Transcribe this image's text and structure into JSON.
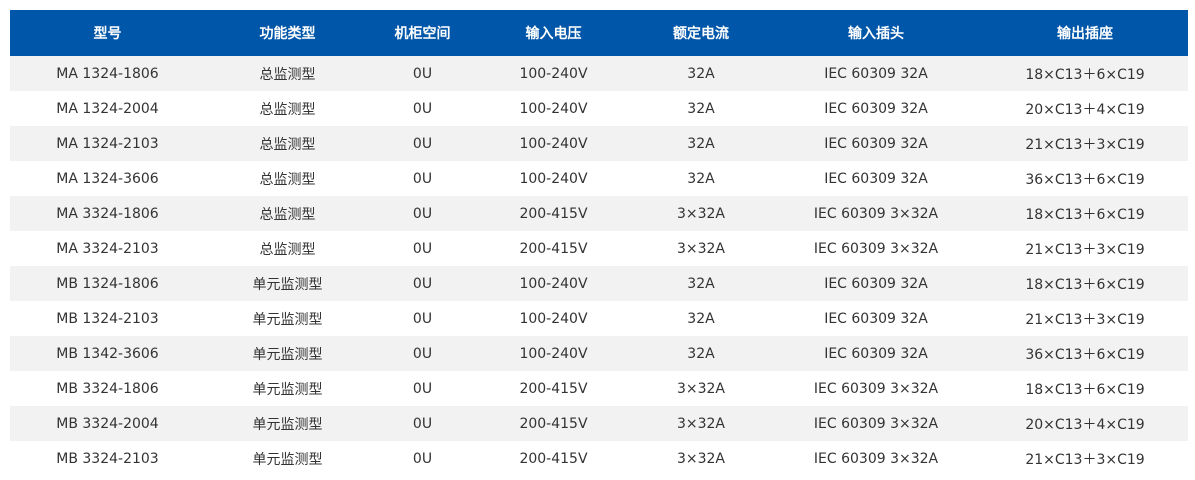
{
  "colors": {
    "header_bg": "#0056a8",
    "header_text": "#ffffff",
    "row_alt": "#f2f2f2",
    "text": "#333333"
  },
  "table": {
    "headers": [
      "型号",
      "功能类型",
      "机柜空间",
      "输入电压",
      "额定电流",
      "输入插头",
      "输出插座"
    ],
    "rows": [
      [
        "MA 1324-1806",
        "总监测型",
        "0U",
        "100-240V",
        "32A",
        "IEC 60309 32A",
        "18×C13＋6×C19"
      ],
      [
        "MA 1324-2004",
        "总监测型",
        "0U",
        "100-240V",
        "32A",
        "IEC 60309 32A",
        "20×C13＋4×C19"
      ],
      [
        "MA 1324-2103",
        "总监测型",
        "0U",
        "100-240V",
        "32A",
        "IEC 60309 32A",
        "21×C13＋3×C19"
      ],
      [
        "MA 1324-3606",
        "总监测型",
        "0U",
        "100-240V",
        "32A",
        "IEC 60309 32A",
        "36×C13＋6×C19"
      ],
      [
        "MA 3324-1806",
        "总监测型",
        "0U",
        "200-415V",
        "3×32A",
        "IEC 60309 3×32A",
        "18×C13＋6×C19"
      ],
      [
        "MA 3324-2103",
        "总监测型",
        "0U",
        "200-415V",
        "3×32A",
        "IEC 60309 3×32A",
        "21×C13＋3×C19"
      ],
      [
        "MB 1324-1806",
        "单元监测型",
        "0U",
        "100-240V",
        "32A",
        "IEC 60309 32A",
        "18×C13＋6×C19"
      ],
      [
        "MB 1324-2103",
        "单元监测型",
        "0U",
        "100-240V",
        "32A",
        "IEC 60309 32A",
        "21×C13＋3×C19"
      ],
      [
        "MB 1342-3606",
        "单元监测型",
        "0U",
        "100-240V",
        "32A",
        "IEC 60309 32A",
        "36×C13＋6×C19"
      ],
      [
        "MB 3324-1806",
        "单元监测型",
        "0U",
        "200-415V",
        "3×32A",
        "IEC 60309 3×32A",
        "18×C13＋6×C19"
      ],
      [
        "MB 3324-2004",
        "单元监测型",
        "0U",
        "200-415V",
        "3×32A",
        "IEC 60309 3×32A",
        "20×C13＋4×C19"
      ],
      [
        "MB 3324-2103",
        "单元监测型",
        "0U",
        "200-415V",
        "3×32A",
        "IEC 60309 3×32A",
        "21×C13＋3×C19"
      ]
    ]
  }
}
